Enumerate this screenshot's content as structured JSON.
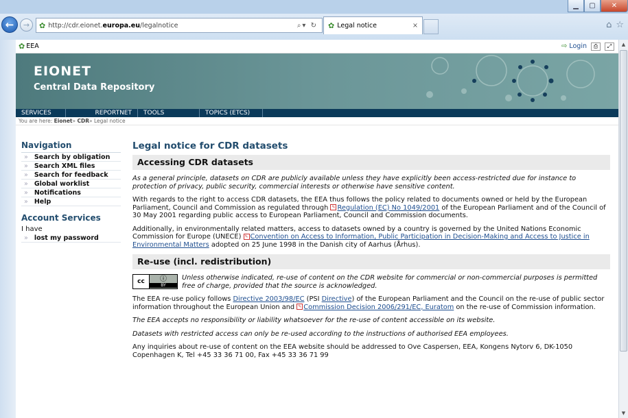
{
  "browser": {
    "address_prefix": "http://cdr.eionet.",
    "address_domain": "europa.eu",
    "address_path": "/legalnotice",
    "tab_title": "Legal notice"
  },
  "topbar": {
    "org": "EEA",
    "login": "Login"
  },
  "banner": {
    "title": "Eionet",
    "subtitle": "Central Data Repository"
  },
  "nav": [
    "Services",
    "ReportNet",
    "Tools",
    "Topics (ETCs)"
  ],
  "breadcrumb": {
    "prefix": "You are here:",
    "items": [
      "Eionet",
      "CDR",
      "Legal notice"
    ]
  },
  "sidebar": {
    "nav_title": "Navigation",
    "items": [
      "Search by obligation",
      "Search XML files",
      "Search for feedback",
      "Global worklist",
      "Notifications",
      "Help"
    ],
    "account_title": "Account Services",
    "i_have": "I have",
    "account_items": [
      "lost my password"
    ]
  },
  "main": {
    "title": "Legal notice for CDR datasets",
    "sec1": "Accessing CDR datasets",
    "p1": "As a general principle, datasets on CDR are publicly available unless they have explicitly been access-restricted due for instance to protection of privacy, public security, commercial interests or otherwise have sensitive content.",
    "p2_a": "With regards to the right to access CDR datasets, the EEA thus follows the policy related to documents owned or held by the European Parliament, Council and Commission as regulated through",
    "p2_link": "Regulation (EC) No 1049/2001",
    "p2_b": "of the European Parliament and of the Council of 30 May 2001 regarding public access to European Parliament, Council and Commission documents.",
    "p3_a": "Additionally, in environmentally related matters, access to datasets owned by a country is governed by the United Nations Economic Commission for Europe (UNECE)",
    "p3_link": "Convention on Access to Information, Public Participation in Decision-Making and Access to Justice in Environmental Matters",
    "p3_b": "adopted on 25 June 1998 in the Danish city of Aarhus (Århus).",
    "sec2": "Re-use (incl. redistribution)",
    "cc_text": "Unless otherwise indicated, re-use of content on the CDR website for commercial or non-commercial purposes is permitted free of charge, provided that the source is acknowledged.",
    "p4_a": "The EEA re-use policy follows",
    "p4_link1": "Directive 2003/98/EC",
    "p4_psi_open": "(",
    "p4_psi": "PSI",
    "p4_psi_link": "Directive",
    "p4_psi_close": ")",
    "p4_b": "of the European Parliament and the Council on the re-use of public sector information throughout the European Union and",
    "p4_link2": "Commission Decision 2006/291/EC, Euratom",
    "p4_c": "on the re-use of Commission information.",
    "p5": "The EEA accepts no responsibility or liability whatsoever for the re-use of content accessible on its website.",
    "p6": "Datasets with restricted access can only be re-used according to the instructions of authorised EEA employees.",
    "p7": "Any inquiries about re-use of content on the EEA website should be addressed to Ove Caspersen, EEA, Kongens Nytorv 6, DK-1050 Copenhagen K, Tel +45 33 36 71 00, Fax +45 33 36 71 99"
  },
  "colors": {
    "heading": "#234d6e",
    "navbar": "#0b3a5a",
    "banner": "#6b9698",
    "link": "#1d4d8f"
  }
}
